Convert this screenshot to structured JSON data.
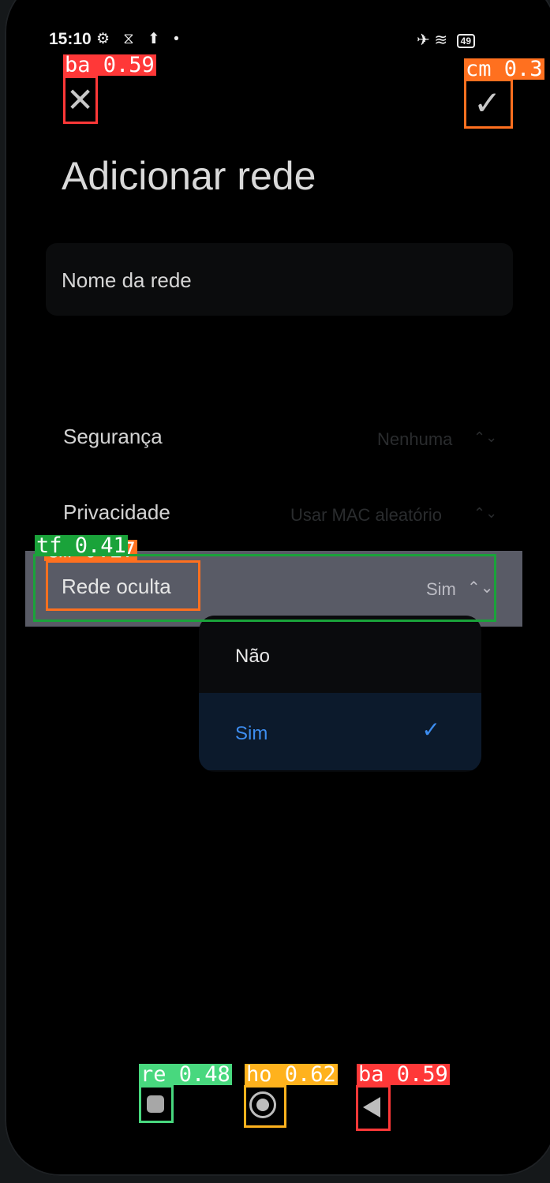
{
  "status_bar": {
    "time": "15:10",
    "left_icons": "⚙ ⧖ ⬆ •",
    "right_icons": "✈ ≋",
    "battery": "49"
  },
  "header": {
    "close_icon": "✕",
    "confirm_icon": "✓",
    "title": "Adicionar rede"
  },
  "form": {
    "network_name_placeholder": "Nome da rede",
    "security_label": "Segurança",
    "security_value": "Nenhuma",
    "privacy_label": "Privacidade",
    "privacy_value": "Usar MAC aleatório",
    "hidden_label": "Rede oculta",
    "hidden_value": "Sim",
    "updown_icon": "⌃⌄"
  },
  "dropdown": {
    "options": [
      {
        "label": "Não",
        "selected": false
      },
      {
        "label": "Sim",
        "selected": true
      }
    ],
    "check_icon": "✓",
    "selected_color": "#3d8df0"
  },
  "detections": [
    {
      "tag": "ba 0.59",
      "color": "#ff3838"
    },
    {
      "tag": "cm 0.3",
      "color": "#ff701f"
    },
    {
      "tag": "tf 0.41",
      "color": "#1aa33a"
    },
    {
      "tag": "cm 0.27",
      "color": "#ff701f"
    },
    {
      "tag": "re 0.48",
      "color": "#48d87e"
    },
    {
      "tag": "ho 0.62",
      "color": "#ffb21d"
    },
    {
      "tag": "ba 0.59",
      "color": "#ff3838"
    }
  ]
}
